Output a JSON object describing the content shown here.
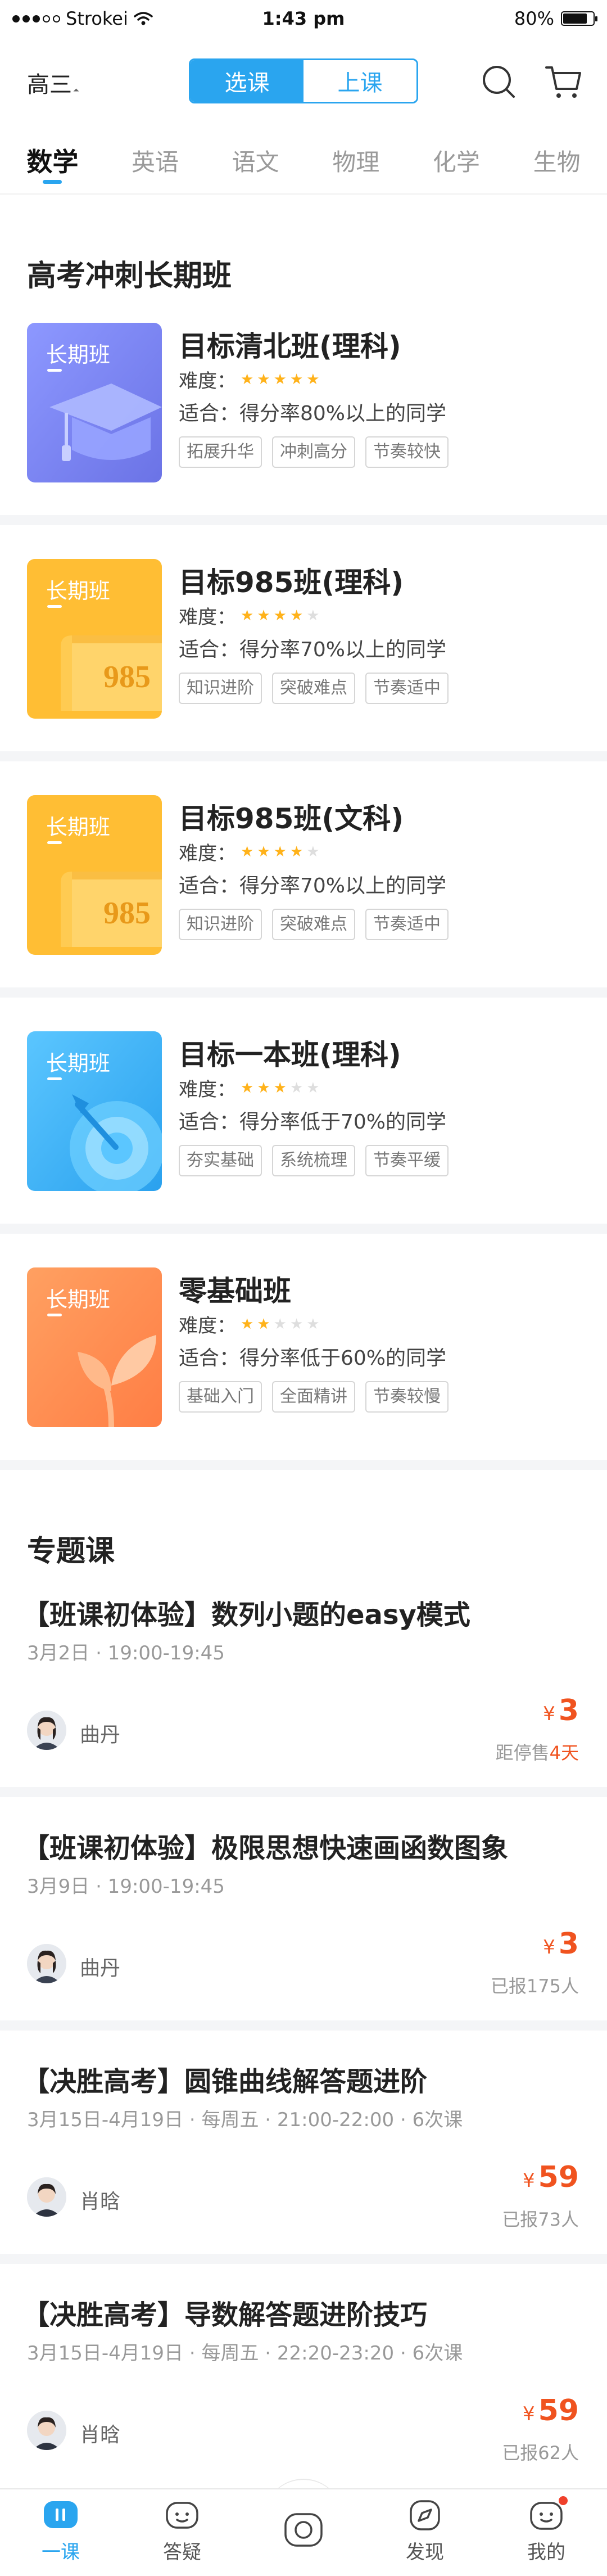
{
  "status_bar": {
    "carrier": "Strokei",
    "time": "1:43 pm",
    "battery": "80%",
    "battery_level": 0.8
  },
  "header": {
    "grade": "高三",
    "segments": [
      {
        "label": "选课",
        "active": true
      },
      {
        "label": "上课",
        "active": false
      }
    ],
    "icons": [
      "search-icon",
      "cart-icon"
    ]
  },
  "subjects": [
    "数学",
    "英语",
    "语文",
    "物理",
    "化学",
    "生物"
  ],
  "long_term": {
    "section_title": "高考冲刺长期班",
    "cover_label": "长期班",
    "difficulty_label": "难度：",
    "courses": [
      {
        "title": "目标清北班(理科)",
        "stars": 5,
        "fit": "适合：得分率80%以上的同学",
        "tags": [
          "拓展升华",
          "冲刺高分",
          "节奏较快"
        ],
        "cover_color": "#7b86f0",
        "art": "graduation-cap"
      },
      {
        "title": "目标985班(理科)",
        "stars": 4,
        "fit": "适合：得分率70%以上的同学",
        "tags": [
          "知识进阶",
          "突破难点",
          "节奏适中"
        ],
        "cover_color": "#ffbd2c",
        "art": "scroll-985",
        "art_text": "985"
      },
      {
        "title": "目标985班(文科)",
        "stars": 4,
        "fit": "适合：得分率70%以上的同学",
        "tags": [
          "知识进阶",
          "突破难点",
          "节奏适中"
        ],
        "cover_color": "#ffbd2c",
        "art": "scroll-985",
        "art_text": "985"
      },
      {
        "title": "目标一本班(理科)",
        "stars": 3,
        "fit": "适合：得分率低于70%的同学",
        "tags": [
          "夯实基础",
          "系统梳理",
          "节奏平缓"
        ],
        "cover_color": "#38b3f4",
        "art": "target-dart"
      },
      {
        "title": "零基础班",
        "stars": 2,
        "fit": "适合：得分率低于60%的同学",
        "tags": [
          "基础入门",
          "全面精讲",
          "节奏较慢"
        ],
        "cover_color": "#ff8d52",
        "art": "sprout"
      }
    ]
  },
  "topics": {
    "section_title": "专题课",
    "currency": "¥",
    "items": [
      {
        "title": "【班课初体验】数列小题的easy模式",
        "meta": "3月2日 · 19:00-19:45",
        "teacher": "曲丹",
        "price": "3",
        "note_prefix": "距停售",
        "note_highlight": "4天",
        "note_suffix": ""
      },
      {
        "title": "【班课初体验】极限思想快速画函数图象",
        "meta": "3月9日 · 19:00-19:45",
        "teacher": "曲丹",
        "price": "3",
        "note_prefix": "已报175人",
        "note_highlight": "",
        "note_suffix": ""
      },
      {
        "title": "【决胜高考】圆锥曲线解答题进阶",
        "meta": "3月15日-4月19日 · 每周五 · 21:00-22:00 · 6次课",
        "teacher": "肖晗",
        "price": "59",
        "note_prefix": "已报73人",
        "note_highlight": "",
        "note_suffix": ""
      },
      {
        "title": "【决胜高考】导数解答题进阶技巧",
        "meta": "3月15日-4月19日 · 每周五 · 22:20-23:20 · 6次课",
        "teacher": "肖晗",
        "price": "59",
        "note_prefix": "已报62人",
        "note_highlight": "",
        "note_suffix": ""
      }
    ]
  },
  "tabbar": [
    {
      "label": "一课",
      "icon": "yike-icon",
      "active": true
    },
    {
      "label": "答疑",
      "icon": "qa-icon",
      "active": false
    },
    {
      "label": "",
      "icon": "camera-icon",
      "active": false
    },
    {
      "label": "发现",
      "icon": "compass-icon",
      "active": false
    },
    {
      "label": "我的",
      "icon": "profile-icon",
      "active": false,
      "badge": true
    }
  ]
}
